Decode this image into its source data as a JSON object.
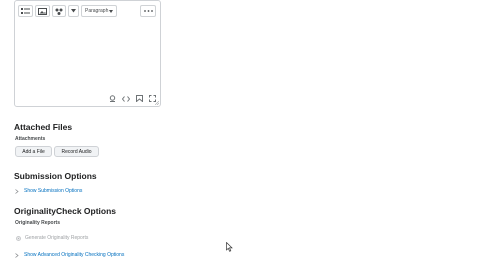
{
  "editor": {
    "toolbar": {
      "paragraph_label": "Paragraph",
      "icons": [
        "list-icon",
        "insert-image-icon",
        "insert-stuff-icon",
        "chevron-down-icon"
      ]
    },
    "more_icon": "more-options-icon",
    "footer_icons": [
      "spellcheck-icon",
      "source-code-icon",
      "emoticon-icon",
      "fullscreen-icon",
      "resize-grip-icon"
    ]
  },
  "attached_files": {
    "title": "Attached Files",
    "subtitle": "Attachments",
    "add_file_label": "Add a File",
    "record_audio_label": "Record Audio"
  },
  "submission_options": {
    "title": "Submission Options",
    "show_link": "Show Submission Options"
  },
  "originality": {
    "title": "OriginalityCheck Options",
    "subtitle": "Originality Reports",
    "generate_label": "Generate Originality Reports",
    "advanced_link": "Show Advanced Originality Checking Options"
  }
}
